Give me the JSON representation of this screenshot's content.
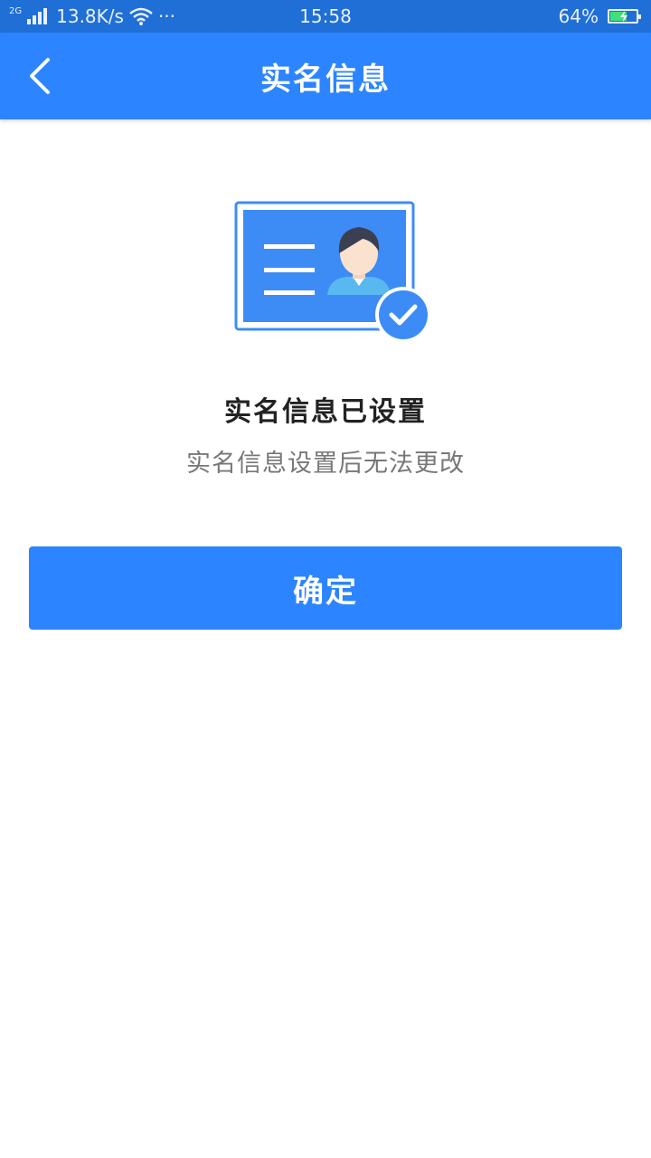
{
  "status_bar": {
    "network_type": "2G",
    "speed": "13.8K/s",
    "more": "···",
    "time": "15:58",
    "battery": "64%",
    "battery_level": 0.64,
    "icons": [
      "signal-icon",
      "wifi-icon",
      "battery-charging-icon"
    ]
  },
  "header": {
    "title": "实名信息",
    "back_icon": "chevron-left-icon"
  },
  "main": {
    "illustration_icon": "id-card-verified-icon",
    "title": "实名信息已设置",
    "subtitle": "实名信息设置后无法更改",
    "confirm_label": "确定"
  },
  "colors": {
    "status_bar": "#1f6fd6",
    "primary": "#2d84ff",
    "title_text": "#222222",
    "subtitle_text": "#777777"
  }
}
